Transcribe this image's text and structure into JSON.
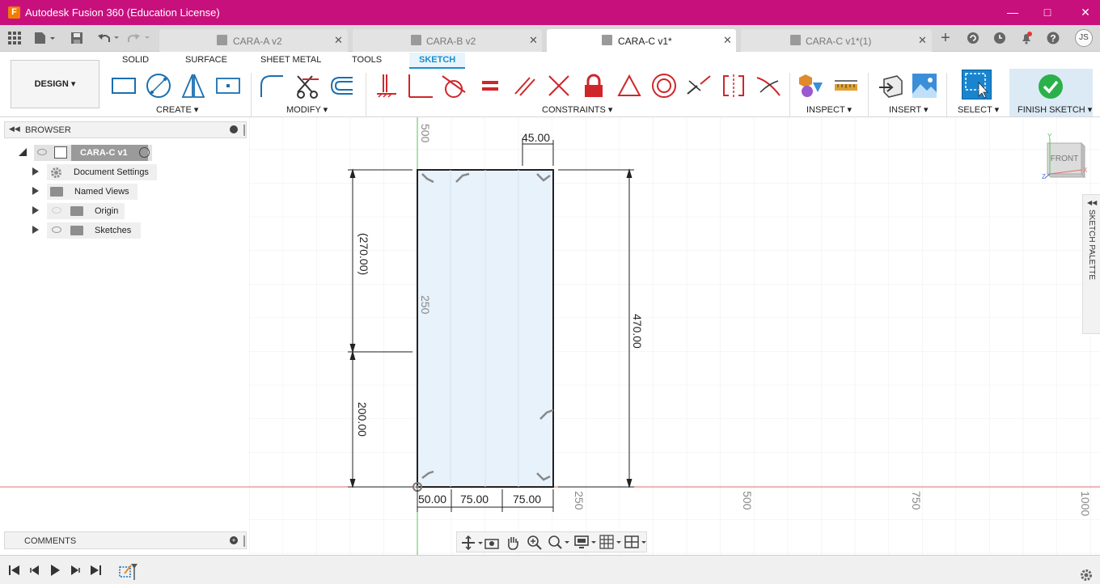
{
  "window": {
    "title": "Autodesk Fusion 360 (Education License)",
    "app_icon_letter": "F"
  },
  "tabs": [
    {
      "label": "CARA-A v2",
      "active": false
    },
    {
      "label": "CARA-B v2",
      "active": false
    },
    {
      "label": "CARA-C v1*",
      "active": true
    },
    {
      "label": "CARA-C v1*(1)",
      "active": false
    }
  ],
  "user_initials": "JS",
  "workspace": "DESIGN",
  "ribbon_tabs": [
    "SOLID",
    "SURFACE",
    "SHEET METAL",
    "TOOLS",
    "SKETCH"
  ],
  "active_ribbon_tab": "SKETCH",
  "groups": {
    "create": "CREATE",
    "modify": "MODIFY",
    "constraints": "CONSTRAINTS",
    "inspect": "INSPECT",
    "insert": "INSERT",
    "select": "SELECT",
    "finish": "FINISH SKETCH"
  },
  "browser": {
    "header": "BROWSER",
    "root": "CARA-C v1",
    "items": [
      "Document Settings",
      "Named Views",
      "Origin",
      "Sketches"
    ]
  },
  "comments_label": "COMMENTS",
  "sketch_palette_label": "SKETCH PALETTE",
  "viewcube": {
    "face": "FRONT",
    "axis_x": "X",
    "axis_y": "Y",
    "axis_z": "Z"
  },
  "dimensions": {
    "top_width": "45.00",
    "right_height": "470.00",
    "left_upper": "(270.00)",
    "left_lower": "200.00",
    "bottom_a": "50.00",
    "bottom_b": "75.00",
    "bottom_c": "75.00"
  },
  "grid_labels": {
    "v_500": "500",
    "v_250": "250",
    "h_250": "250",
    "h_500": "500",
    "h_750": "750",
    "h_1000": "1000"
  },
  "colors": {
    "title_bar": "#c8107c",
    "accent": "#1a8ecb",
    "finish_check": "#2bb04a",
    "constraint_red": "#d0262a",
    "x_axis": "#e07070",
    "y_axis": "#59c15a"
  }
}
